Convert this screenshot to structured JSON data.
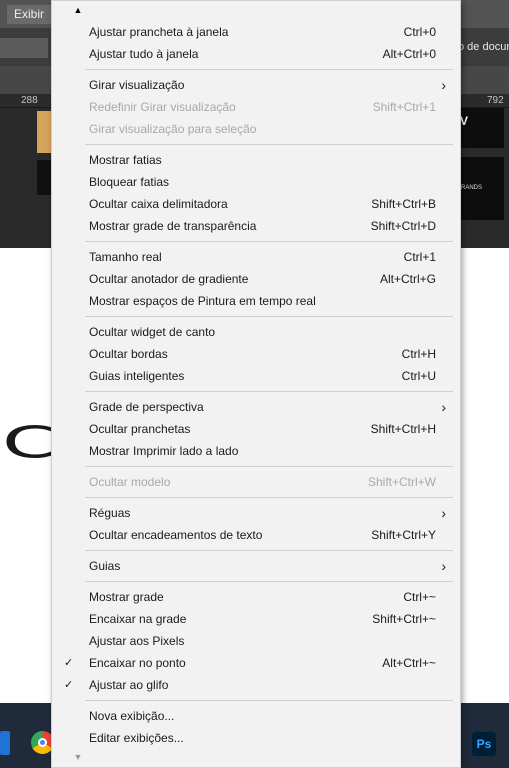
{
  "app": {
    "menu_button": "Exibir",
    "doc_label": "o de docum",
    "ruler_left": "288",
    "ruler_right": "792",
    "thumb_text": "V",
    "thumb_text2": "RANDS",
    "taskbar_ps": "Ps"
  },
  "menu": {
    "groups": [
      [
        {
          "label": "Ajustar prancheta à janela",
          "shortcut": "Ctrl+0"
        },
        {
          "label": "Ajustar tudo à janela",
          "shortcut": "Alt+Ctrl+0"
        }
      ],
      [
        {
          "label": "Girar visualização",
          "submenu": true
        },
        {
          "label": "Redefinir Girar visualização",
          "shortcut": "Shift+Ctrl+1",
          "disabled": true
        },
        {
          "label": "Girar visualização para seleção",
          "disabled": true
        }
      ],
      [
        {
          "label": "Mostrar fatias"
        },
        {
          "label": "Bloquear fatias"
        },
        {
          "label": "Ocultar caixa delimitadora",
          "shortcut": "Shift+Ctrl+B"
        },
        {
          "label": "Mostrar grade de transparência",
          "shortcut": "Shift+Ctrl+D"
        }
      ],
      [
        {
          "label": "Tamanho real",
          "shortcut": "Ctrl+1"
        },
        {
          "label": "Ocultar anotador de gradiente",
          "shortcut": "Alt+Ctrl+G"
        },
        {
          "label": "Mostrar espaços de Pintura em tempo real"
        }
      ],
      [
        {
          "label": "Ocultar widget de canto"
        },
        {
          "label": "Ocultar bordas",
          "shortcut": "Ctrl+H"
        },
        {
          "label": "Guias inteligentes",
          "shortcut": "Ctrl+U"
        }
      ],
      [
        {
          "label": "Grade de perspectiva",
          "submenu": true
        },
        {
          "label": "Ocultar pranchetas",
          "shortcut": "Shift+Ctrl+H"
        },
        {
          "label": "Mostrar Imprimir lado a lado"
        }
      ],
      [
        {
          "label": "Ocultar modelo",
          "shortcut": "Shift+Ctrl+W",
          "disabled": true
        }
      ],
      [
        {
          "label": "Réguas",
          "submenu": true
        },
        {
          "label": "Ocultar encadeamentos de texto",
          "shortcut": "Shift+Ctrl+Y"
        }
      ],
      [
        {
          "label": "Guias",
          "submenu": true
        }
      ],
      [
        {
          "label": "Mostrar grade",
          "shortcut": "Ctrl+~"
        },
        {
          "label": "Encaixar na grade",
          "shortcut": "Shift+Ctrl+~"
        },
        {
          "label": "Ajustar aos Pixels"
        },
        {
          "label": "Encaixar no ponto",
          "shortcut": "Alt+Ctrl+~",
          "checked": true
        },
        {
          "label": "Ajustar ao glifo",
          "checked": true
        }
      ],
      [
        {
          "label": "Nova exibição..."
        },
        {
          "label": "Editar exibições..."
        }
      ]
    ]
  }
}
